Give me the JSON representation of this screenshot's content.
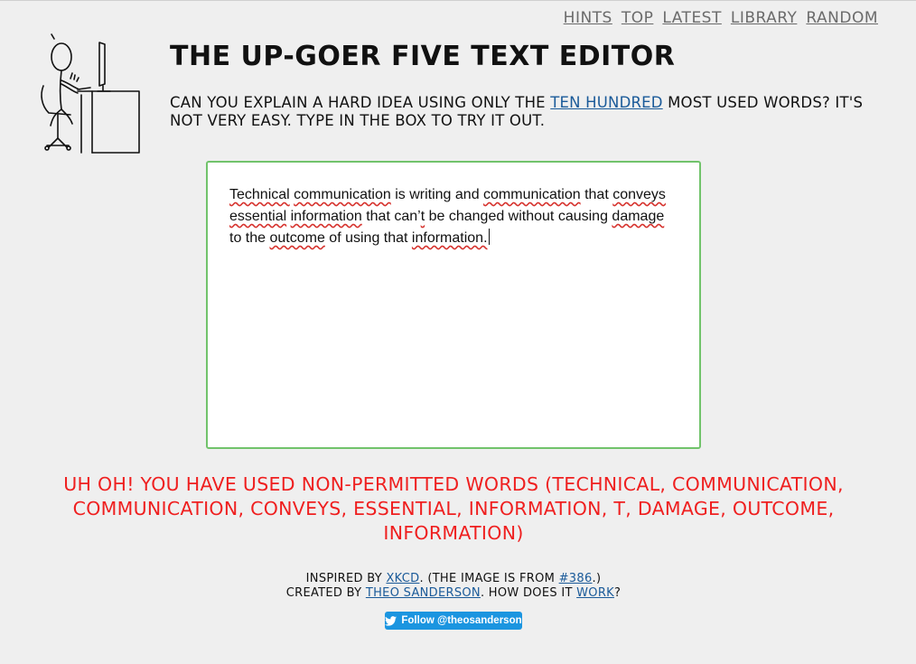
{
  "nav": [
    {
      "label": "Hints"
    },
    {
      "label": "Top"
    },
    {
      "label": "Latest"
    },
    {
      "label": "Library"
    },
    {
      "label": "Random"
    }
  ],
  "header": {
    "title": "The Up-Goer Five Text Editor",
    "intro_before": "Can you explain a hard idea using only the ",
    "intro_link": "ten hundred",
    "intro_after": " most used words? It's not very easy. Type in the box to try it out."
  },
  "editor": {
    "segments": [
      {
        "text": "Technical",
        "bad": true
      },
      {
        "text": " ",
        "bad": false
      },
      {
        "text": "communication",
        "bad": true
      },
      {
        "text": " is writing and ",
        "bad": false
      },
      {
        "text": "communication",
        "bad": true
      },
      {
        "text": " that ",
        "bad": false
      },
      {
        "text": "conveys",
        "bad": true
      },
      {
        "text": " ",
        "bad": false
      },
      {
        "text": "essential",
        "bad": true
      },
      {
        "text": " ",
        "bad": false
      },
      {
        "text": "information",
        "bad": true
      },
      {
        "text": " that can’",
        "bad": false
      },
      {
        "text": "t",
        "bad": true
      },
      {
        "text": " be changed without causing ",
        "bad": false
      },
      {
        "text": "damage",
        "bad": true
      },
      {
        "text": " to the ",
        "bad": false
      },
      {
        "text": "outcome",
        "bad": true
      },
      {
        "text": " of using that ",
        "bad": false
      },
      {
        "text": "information.",
        "bad": true
      }
    ]
  },
  "error": {
    "message": "Uh oh! You have used non-permitted words (technical, communication, communication, conveys, essential, information, t, damage, outcome, information)"
  },
  "footer": {
    "inspired_prefix": "Inspired by ",
    "xkcd_link": "xkcd",
    "image_from": ". (The image is from ",
    "comic_link": "#386",
    "image_close": ".)",
    "created_prefix": "Created by ",
    "author_link": "Theo Sanderson",
    "how_prefix": ". How does it ",
    "work_link": "work",
    "how_suffix": "?"
  },
  "twitter": {
    "label": "Follow @theosanderson",
    "icon": "twitter-bird-icon"
  },
  "colors": {
    "error": "#ef1f1f",
    "link": "#1a5a99",
    "editor_border": "#71c36b",
    "twitter": "#1b95e0"
  }
}
